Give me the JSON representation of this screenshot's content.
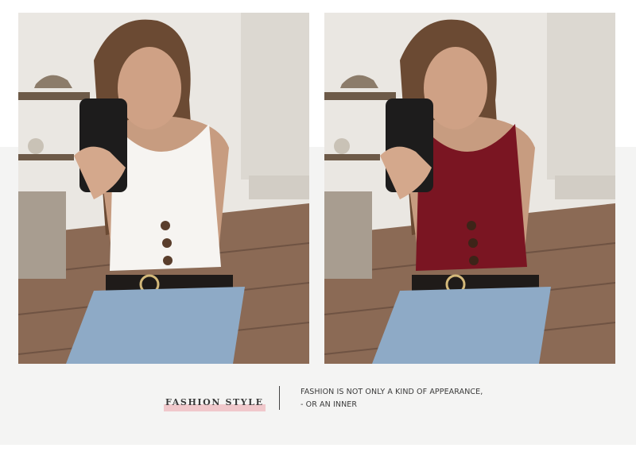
{
  "products": [
    {
      "color_name": "white",
      "top_color": "#f6f4f1"
    },
    {
      "color_name": "burgundy",
      "top_color": "#7a1522"
    }
  ],
  "caption": {
    "headline": "FASHION STYLE",
    "tagline_line1": "FASHION IS NOT ONLY A KIND OF APPEARANCE,",
    "tagline_line2": "- OR AN INNER"
  },
  "colors": {
    "band_background": "#f4f4f3",
    "headline_highlight": "#f0c8cb",
    "text": "#3a3a3a"
  }
}
